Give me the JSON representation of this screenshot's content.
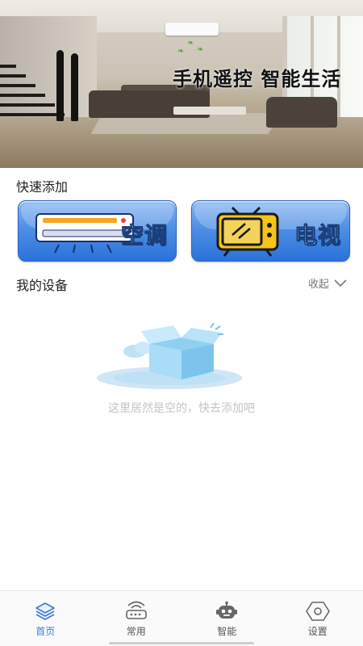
{
  "banner": {
    "slogan": "手机遥控 智能生活"
  },
  "quick_add": {
    "title": "快速添加",
    "cards": [
      {
        "label": "空调",
        "icon": "air-conditioner-icon"
      },
      {
        "label": "电视",
        "icon": "tv-icon"
      }
    ]
  },
  "my_devices": {
    "title": "我的设备",
    "collapse_label": "收起",
    "empty_text": "这里居然是空的，快去添加吧"
  },
  "bottom_nav": {
    "items": [
      {
        "label": "首页",
        "icon": "layers-icon",
        "active": true
      },
      {
        "label": "常用",
        "icon": "router-icon",
        "active": false
      },
      {
        "label": "智能",
        "icon": "robot-icon",
        "active": false
      },
      {
        "label": "设置",
        "icon": "hexagon-settings-icon",
        "active": false
      }
    ]
  },
  "colors": {
    "accent": "#3d7bd9",
    "card_blue": "#4f8fe5",
    "empty_text": "#c4c4c4"
  }
}
